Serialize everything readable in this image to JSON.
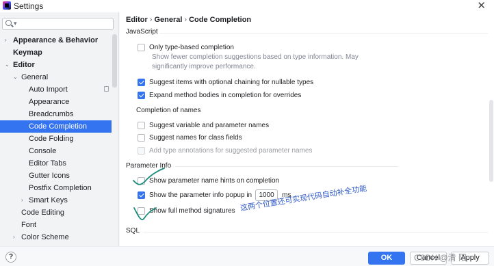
{
  "window": {
    "title": "Settings"
  },
  "search": {
    "placeholder": ""
  },
  "sidebar": {
    "items": [
      {
        "label": "Appearance & Behavior",
        "arrow": "›",
        "bold": true
      },
      {
        "label": "Keymap",
        "arrow": "",
        "bold": true
      },
      {
        "label": "Editor",
        "arrow": "⌄",
        "bold": true
      },
      {
        "label": "General",
        "arrow": "⌄",
        "bold": false
      },
      {
        "label": "Auto Import",
        "arrow": "",
        "bold": false
      },
      {
        "label": "Appearance",
        "arrow": "",
        "bold": false
      },
      {
        "label": "Breadcrumbs",
        "arrow": "",
        "bold": false
      },
      {
        "label": "Code Completion",
        "arrow": "",
        "bold": false,
        "selected": true
      },
      {
        "label": "Code Folding",
        "arrow": "",
        "bold": false
      },
      {
        "label": "Console",
        "arrow": "",
        "bold": false
      },
      {
        "label": "Editor Tabs",
        "arrow": "",
        "bold": false
      },
      {
        "label": "Gutter Icons",
        "arrow": "",
        "bold": false
      },
      {
        "label": "Postfix Completion",
        "arrow": "",
        "bold": false
      },
      {
        "label": "Smart Keys",
        "arrow": "›",
        "bold": false
      },
      {
        "label": "Code Editing",
        "arrow": "",
        "bold": false
      },
      {
        "label": "Font",
        "arrow": "",
        "bold": false
      },
      {
        "label": "Color Scheme",
        "arrow": "›",
        "bold": false
      }
    ]
  },
  "breadcrumb": {
    "part1": "Editor",
    "part2": "General",
    "part3": "Code Completion",
    "sep": "›"
  },
  "main": {
    "javascript": {
      "heading": "JavaScript",
      "only_type_based": {
        "label": "Only type-based completion",
        "checked": false
      },
      "only_type_based_desc_1": "Show fewer completion suggestions based on type information. May",
      "only_type_based_desc_2": "significantly improve performance.",
      "optional_chaining": {
        "label": "Suggest items with optional chaining for nullable types",
        "checked": true
      },
      "expand_bodies": {
        "label": "Expand method bodies in completion for overrides",
        "checked": true
      },
      "names_heading": "Completion of names",
      "var_param_names": {
        "label": "Suggest variable and parameter names",
        "checked": false
      },
      "class_fields": {
        "label": "Suggest names for class fields",
        "checked": false
      },
      "type_annotations": {
        "label": "Add type annotations for suggested parameter names",
        "checked": false,
        "disabled": true
      }
    },
    "parameter_info": {
      "heading": "Parameter Info",
      "name_hints": {
        "label": "Show parameter name hints on completion",
        "checked": false
      },
      "popup": {
        "label": "Show the parameter info popup in",
        "checked": true,
        "value": "1000",
        "unit": "ms"
      },
      "full_signatures": {
        "label": "Show full method signatures",
        "checked": false
      }
    },
    "sql": {
      "heading": "SQL"
    }
  },
  "annotation": {
    "text": "这两个位置还可实现代码自动补全功能",
    "color": "#2d57c8"
  },
  "footer": {
    "help": "?",
    "ok": "OK",
    "cancel": "Cancel",
    "apply": "Apply",
    "watermark": "CSDN @清 阳"
  },
  "colors": {
    "accent": "#3574f0",
    "annotation": "#1a8b7a"
  },
  "icons": [
    "app-icon",
    "close-icon",
    "search-icon",
    "reset-icon",
    "help-icon"
  ]
}
